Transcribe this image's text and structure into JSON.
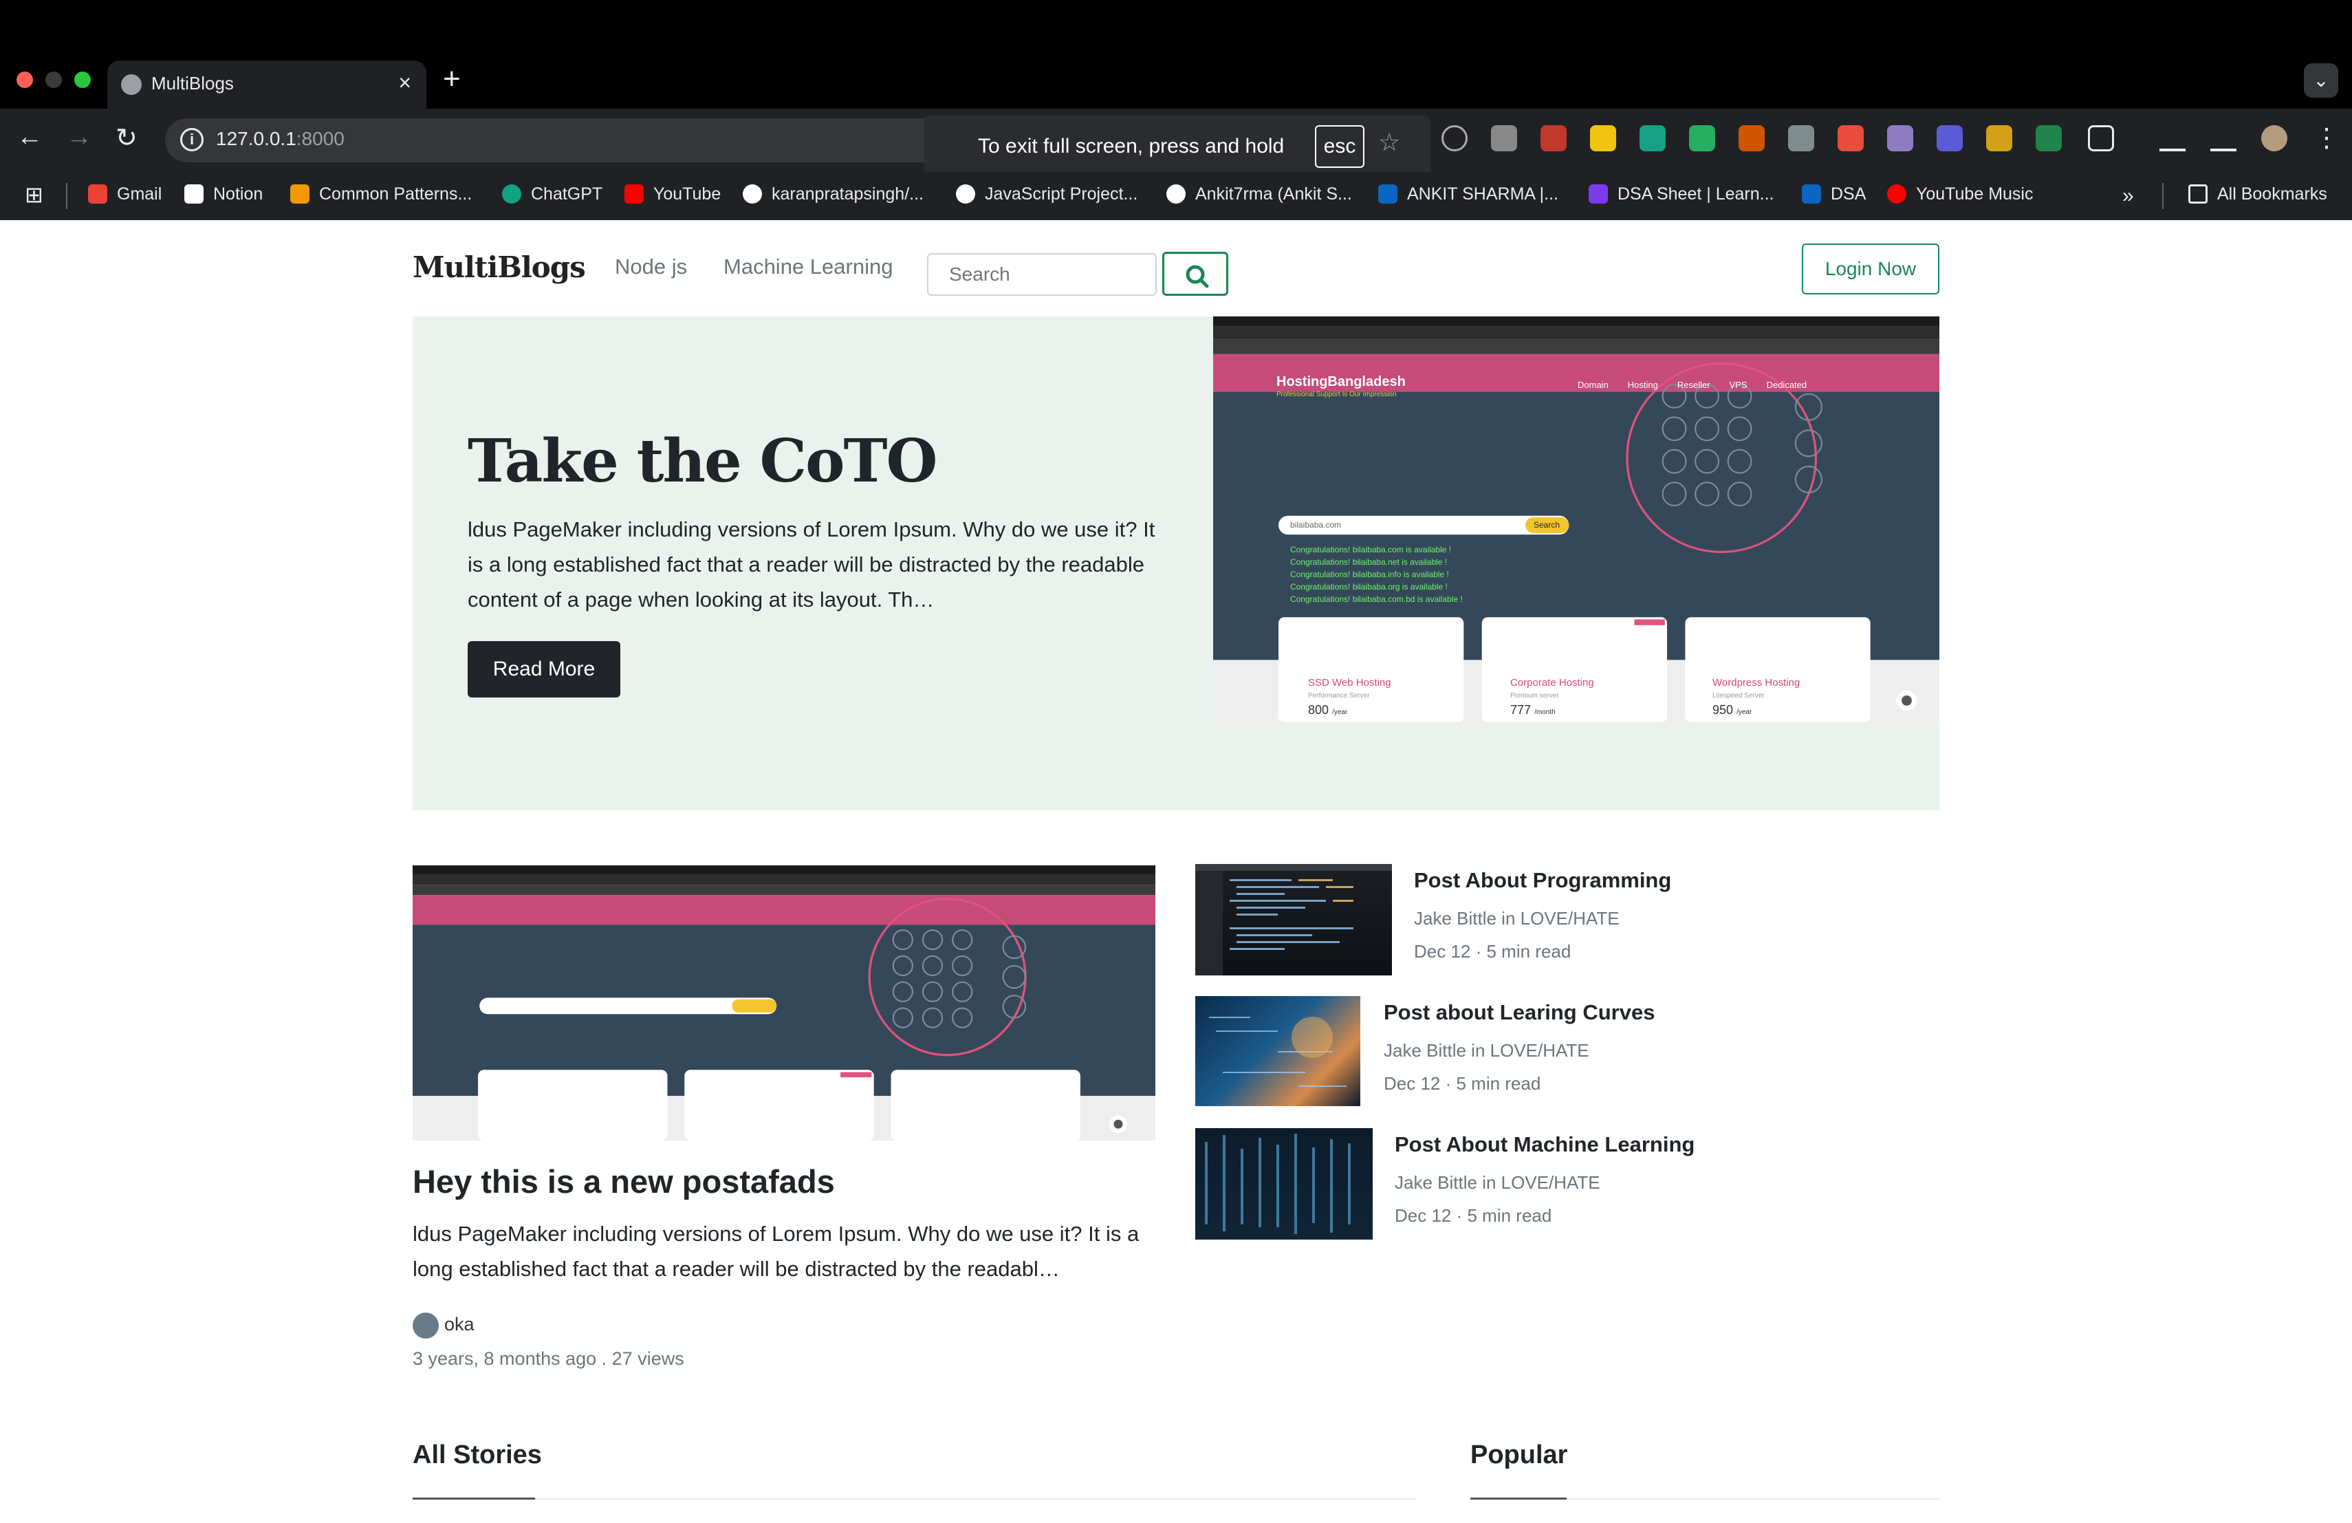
{
  "browser": {
    "tab_title": "MultiBlogs",
    "new_tab_symbol": "+",
    "close_symbol": "×",
    "url_host": "127.0.0.1",
    "url_port": ":8000",
    "fullscreen_notice": "To exit full screen, press and hold",
    "fullscreen_key": "esc",
    "bookmarks": [
      {
        "label": "Gmail",
        "color": "#ea4335"
      },
      {
        "label": "Notion",
        "color": "#ffffff"
      },
      {
        "label": "Common Patterns...",
        "color": "#f29900"
      },
      {
        "label": "ChatGPT",
        "color": "#10a37f"
      },
      {
        "label": "YouTube",
        "color": "#ff0000"
      },
      {
        "label": "karanpratapsingh/...",
        "color": "#ffffff"
      },
      {
        "label": "JavaScript Project...",
        "color": "#ffffff"
      },
      {
        "label": "Ankit7rma (Ankit S...",
        "color": "#ffffff"
      },
      {
        "label": "ANKIT SHARMA |...",
        "color": "#0a66c2"
      },
      {
        "label": "DSA Sheet | Learn...",
        "color": "#7c3aed"
      },
      {
        "label": "DSA",
        "color": "#0a66c2"
      },
      {
        "label": "YouTube Music",
        "color": "#ff0000"
      }
    ],
    "all_bookmarks": "All Bookmarks"
  },
  "site": {
    "brand": "MultiBlogs",
    "nav": [
      "Node js",
      "Machine Learning"
    ],
    "search_placeholder": "Search",
    "login": "Login Now",
    "accent": "#198754"
  },
  "hero": {
    "title": "Take the CoTO",
    "excerpt": "ldus PageMaker including versions of Lorem Ipsum. Why do we use it? It is a long established fact that a reader will be distracted by the readable content of a page when looking at its layout. Th…",
    "button": "Read More",
    "bg": "#e9f2ec"
  },
  "featured_post": {
    "title": "Hey this is a new postafads",
    "excerpt": "ldus PageMaker including versions of Lorem Ipsum. Why do we use it? It is a long established fact that a reader will be distracted by the readabl…",
    "author": "oka",
    "meta": "3 years, 8 months ago . 27 views"
  },
  "side_posts": [
    {
      "title": "Post About Programming",
      "author": "Jake Bittle in LOVE/HATE",
      "date": "Dec 12 · 5 min read"
    },
    {
      "title": "Post about Learing Curves",
      "author": "Jake Bittle in LOVE/HATE",
      "date": "Dec 12 · 5 min read"
    },
    {
      "title": "Post About Machine Learning",
      "author": "Jake Bittle in LOVE/HATE",
      "date": "Dec 12 · 5 min read"
    }
  ],
  "sections": {
    "all_stories": "All Stories",
    "popular": "Popular"
  },
  "screenshot_preview": {
    "brand": "HostingBangladesh",
    "tagline": "Professional Support Is Our Impression",
    "menu": [
      "Domain",
      "Hosting",
      "Reseller",
      "VPS",
      "Dedicated"
    ],
    "search_value": "bilaibaba.com",
    "search_btn": "Search",
    "results": [
      "Congratulations! bilaibaba.com is available !",
      "Congratulations! bilaibaba.net is available !",
      "Congratulations! bilaibaba.info is available !",
      "Congratulations! bilaibaba.org is available !",
      "Congratulations! bilaibaba.com.bd is available !"
    ],
    "cards": [
      {
        "name": "SSD Web Hosting",
        "sub": "Performance Server",
        "price": "800",
        "unit": "/year"
      },
      {
        "name": "Corporate Hosting",
        "sub": "Premium server",
        "price": "777",
        "unit": "/month"
      },
      {
        "name": "Wordpress Hosting",
        "sub": "Litespeed Server",
        "price": "950",
        "unit": "/year"
      }
    ]
  }
}
